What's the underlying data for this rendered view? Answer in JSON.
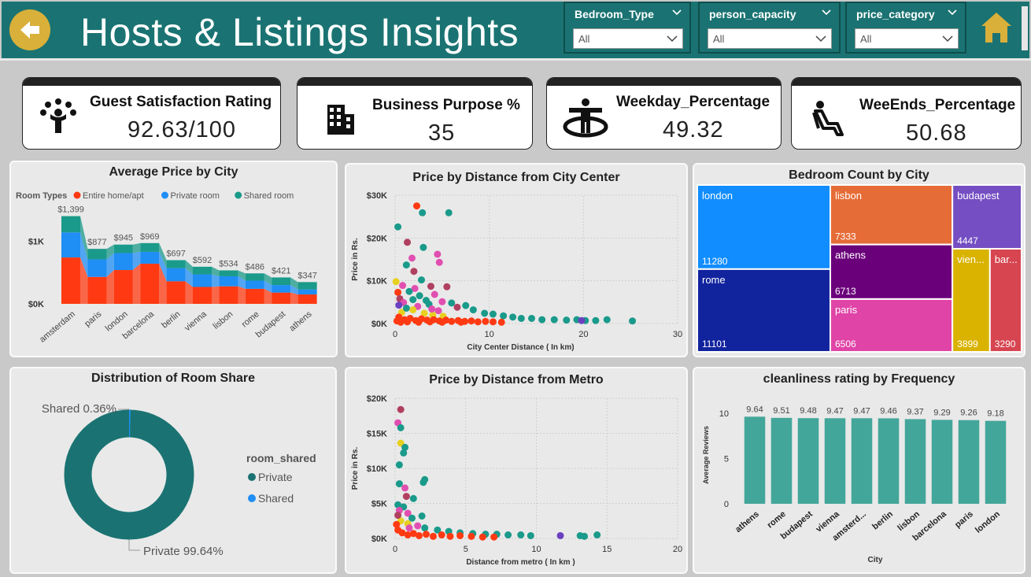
{
  "header": {
    "title": "Hosts & Listings Insights"
  },
  "slicers": [
    {
      "label": "Bedroom_Type",
      "value": "All"
    },
    {
      "label": "person_capacity",
      "value": "All"
    },
    {
      "label": "price_category",
      "value": "All"
    }
  ],
  "kpis": [
    {
      "title": "Guest Satisfaction Rating",
      "value": "92.63/100",
      "icon": "people-group-icon"
    },
    {
      "title": "Business Purpose %",
      "value": "35",
      "icon": "building-icon"
    },
    {
      "title": "Weekday_Percentage",
      "value": "49.32",
      "icon": "person-standing-icon"
    },
    {
      "title": "WeeEnds_Percentage",
      "value": "50.68",
      "icon": "person-seated-icon"
    }
  ],
  "panels": {
    "avg_price": {
      "title": "Average Price by City",
      "legend_title": "Room Types"
    },
    "dist_center": {
      "title": "Price by Distance from City Center"
    },
    "bedroom": {
      "title": "Bedroom Count by City"
    },
    "room_share": {
      "title": "Distribution of Room Share",
      "legend_title": "room_shared",
      "legend": [
        "Private",
        "Shared"
      ],
      "label_shared": "Shared 0.36%",
      "label_private": "Private 99.64%"
    },
    "dist_metro": {
      "title": "Price by Distance from Metro"
    },
    "clean": {
      "title": "cleanliness rating by Frequency"
    }
  },
  "colors": {
    "entire": "#ff3a12",
    "private": "#1f8ef5",
    "shared": "#1a9a8a",
    "teal": "#1a7372",
    "bar": "#43a69a"
  },
  "chart_data": [
    {
      "type": "area",
      "title": "Average Price by City",
      "legend_title": "Room Types",
      "categories": [
        "amsterdam",
        "paris",
        "london",
        "barcelona",
        "berlin",
        "vienna",
        "lisbon",
        "rome",
        "budapest",
        "athens"
      ],
      "totals": [
        "$1,399",
        "$877",
        "$945",
        "$969",
        "$697",
        "$592",
        "$534",
        "$486",
        "$421",
        "$347"
      ],
      "series": [
        {
          "name": "Entire home/apt",
          "color": "#ff3a12",
          "values": [
            740,
            430,
            540,
            640,
            360,
            270,
            280,
            240,
            180,
            150
          ]
        },
        {
          "name": "Private room",
          "color": "#1f8ef5",
          "values": [
            400,
            280,
            270,
            190,
            210,
            200,
            160,
            130,
            120,
            80
          ]
        },
        {
          "name": "Shared room",
          "color": "#1a9a8a",
          "values": [
            259,
            167,
            135,
            139,
            127,
            122,
            94,
            116,
            121,
            117
          ]
        }
      ],
      "yticks": [
        "$0K",
        "$1K"
      ],
      "ylim": [
        0,
        2000
      ]
    },
    {
      "type": "scatter",
      "title": "Price by Distance from City Center",
      "xlabel": "City Center Distance ( In km)",
      "ylabel": "Price in Rs.",
      "xlim": [
        0,
        30
      ],
      "ylim": [
        0,
        30000
      ],
      "xticks": [
        "0",
        "10",
        "20",
        "30"
      ],
      "yticks": [
        "$0K",
        "$10K",
        "$20K",
        "$30K"
      ],
      "points": [
        [
          2.3,
          27500,
          "#ff3a12"
        ],
        [
          2.9,
          25900,
          "#1a9a8a"
        ],
        [
          5.7,
          25900,
          "#1a9a8a"
        ],
        [
          0.3,
          22600,
          "#1a9a8a"
        ],
        [
          1.3,
          19000,
          "#b04060"
        ],
        [
          3.0,
          17800,
          "#1a9a8a"
        ],
        [
          4.5,
          16200,
          "#e04fb0"
        ],
        [
          1.8,
          15300,
          "#e04fb0"
        ],
        [
          4.7,
          14300,
          "#e04fb0"
        ],
        [
          1.2,
          13700,
          "#1a9a8a"
        ],
        [
          2.0,
          12200,
          "#b04060"
        ],
        [
          2.8,
          10200,
          "#1a9a8a"
        ],
        [
          0.8,
          8900,
          "#e04fb0"
        ],
        [
          3.8,
          8700,
          "#b04060"
        ],
        [
          5.5,
          8600,
          "#b04060"
        ],
        [
          2.1,
          8200,
          "#e04fb0"
        ],
        [
          1.5,
          7500,
          "#1a9a8a"
        ],
        [
          0.3,
          7300,
          "#ff3a12"
        ],
        [
          4.2,
          6800,
          "#e04fb0"
        ],
        [
          2.6,
          6500,
          "#1a9a8a"
        ],
        [
          0.5,
          5800,
          "#b04060"
        ],
        [
          1.9,
          5600,
          "#1a9a8a"
        ],
        [
          3.3,
          5400,
          "#1a9a8a"
        ],
        [
          5.0,
          5100,
          "#e04fb0"
        ],
        [
          6.0,
          4800,
          "#1a9a8a"
        ],
        [
          0.9,
          4900,
          "#e04fb0"
        ],
        [
          3.6,
          4500,
          "#1a9a8a"
        ],
        [
          7.5,
          4200,
          "#1a9a8a"
        ],
        [
          2.4,
          4000,
          "#e04fb0"
        ],
        [
          6.6,
          3800,
          "#b04060"
        ],
        [
          8.3,
          3200,
          "#1a9a8a"
        ],
        [
          4.6,
          3000,
          "#e04fb0"
        ],
        [
          9.5,
          2400,
          "#1a9a8a"
        ],
        [
          10.4,
          2200,
          "#1a9a8a"
        ],
        [
          11.5,
          1800,
          "#1a9a8a"
        ],
        [
          12.5,
          1500,
          "#1a9a8a"
        ],
        [
          13.4,
          1200,
          "#1a9a8a"
        ],
        [
          14.5,
          1200,
          "#1a9a8a"
        ],
        [
          15.6,
          900,
          "#1a9a8a"
        ],
        [
          16.9,
          900,
          "#1a9a8a"
        ],
        [
          18.2,
          800,
          "#1a9a8a"
        ],
        [
          19.3,
          900,
          "#1a9a8a"
        ],
        [
          20.2,
          700,
          "#1a9a8a"
        ],
        [
          19.8,
          700,
          "#6b40c0"
        ],
        [
          21.3,
          700,
          "#1a9a8a"
        ],
        [
          22.5,
          900,
          "#1a9a8a"
        ],
        [
          25.2,
          600,
          "#1a9a8a"
        ],
        [
          0.7,
          2600,
          "#e8d020"
        ],
        [
          1.9,
          3200,
          "#e8d020"
        ],
        [
          3.1,
          2400,
          "#e8d020"
        ],
        [
          4.0,
          2000,
          "#e8d020"
        ],
        [
          5.1,
          1700,
          "#e8d020"
        ],
        [
          0.4,
          1500,
          "#ff3a12"
        ],
        [
          1.0,
          900,
          "#ff3a12"
        ],
        [
          1.6,
          1200,
          "#ff3a12"
        ],
        [
          2.2,
          700,
          "#ff3a12"
        ],
        [
          2.8,
          1100,
          "#ff3a12"
        ],
        [
          3.4,
          800,
          "#ff3a12"
        ],
        [
          4.1,
          900,
          "#ff3a12"
        ],
        [
          4.7,
          600,
          "#ff3a12"
        ],
        [
          5.4,
          800,
          "#ff3a12"
        ],
        [
          6.0,
          500,
          "#ff3a12"
        ],
        [
          6.7,
          700,
          "#ff3a12"
        ],
        [
          7.4,
          500,
          "#ff3a12"
        ],
        [
          8.1,
          600,
          "#ff3a12"
        ],
        [
          8.8,
          400,
          "#ff3a12"
        ],
        [
          9.6,
          500,
          "#ff3a12"
        ],
        [
          10.4,
          400,
          "#ff3a12"
        ],
        [
          11.3,
          300,
          "#ff3a12"
        ],
        [
          0.2,
          600,
          "#ff3a12"
        ],
        [
          0.6,
          300,
          "#ff3a12"
        ],
        [
          1.3,
          400,
          "#ff3a12"
        ],
        [
          2.5,
          300,
          "#ff3a12"
        ],
        [
          3.7,
          400,
          "#ff3a12"
        ],
        [
          5.0,
          300,
          "#ff3a12"
        ],
        [
          7.0,
          300,
          "#ff3a12"
        ],
        [
          0.4,
          4300,
          "#6b40c0"
        ],
        [
          1.2,
          3600,
          "#1a9a8a"
        ],
        [
          3.9,
          3400,
          "#e04fb0"
        ],
        [
          0.1,
          9800,
          "#e8d020"
        ]
      ]
    },
    {
      "type": "treemap",
      "title": "Bedroom Count by City",
      "items": [
        {
          "name": "london",
          "value": 11280,
          "color": "#118dff"
        },
        {
          "name": "rome",
          "value": 11101,
          "color": "#12239e"
        },
        {
          "name": "lisbon",
          "value": 7333,
          "color": "#e66c37"
        },
        {
          "name": "athens",
          "value": 6713,
          "color": "#6b007b"
        },
        {
          "name": "paris",
          "value": 6506,
          "color": "#e044a7"
        },
        {
          "name": "budapest",
          "value": 4447,
          "color": "#744ec2"
        },
        {
          "name": "vien...",
          "value": 3899,
          "color": "#d9b300"
        },
        {
          "name": "bar...",
          "value": 3290,
          "color": "#d64550"
        }
      ]
    },
    {
      "type": "pie",
      "title": "Distribution of Room Share",
      "legend_title": "room_shared",
      "slices": [
        {
          "name": "Private",
          "value": 99.64,
          "color": "#1a7372"
        },
        {
          "name": "Shared",
          "value": 0.36,
          "color": "#1f8ef5"
        }
      ]
    },
    {
      "type": "scatter",
      "title": "Price by Distance from Metro",
      "xlabel": "Distance from metro ( In km )",
      "ylabel": "Price in Rs.",
      "xlim": [
        0,
        20
      ],
      "ylim": [
        0,
        20000
      ],
      "xticks": [
        "0",
        "5",
        "10",
        "15",
        "20"
      ],
      "yticks": [
        "$0K",
        "$5K",
        "$10K",
        "$15K",
        "$20K"
      ],
      "points": [
        [
          0.4,
          18400,
          "#b04060"
        ],
        [
          0.2,
          16500,
          "#e04fb0"
        ],
        [
          0.4,
          15800,
          "#1a9a8a"
        ],
        [
          0.4,
          13600,
          "#e8d020"
        ],
        [
          0.7,
          13000,
          "#1a9a8a"
        ],
        [
          0.6,
          12200,
          "#1a9a8a"
        ],
        [
          0.3,
          7800,
          "#1a9a8a"
        ],
        [
          2.0,
          8000,
          "#1a9a8a"
        ],
        [
          0.7,
          7200,
          "#e04fb0"
        ],
        [
          0.8,
          6000,
          "#b04060"
        ],
        [
          1.3,
          5700,
          "#1a9a8a"
        ],
        [
          0.2,
          4800,
          "#1a9a8a"
        ],
        [
          0.6,
          4500,
          "#1a9a8a"
        ],
        [
          0.3,
          4000,
          "#e04fb0"
        ],
        [
          0.9,
          3600,
          "#e04fb0"
        ],
        [
          1.9,
          3200,
          "#1a9a8a"
        ],
        [
          1.2,
          2900,
          "#1a9a8a"
        ],
        [
          0.4,
          2500,
          "#e8d020"
        ],
        [
          0.9,
          2100,
          "#e8d020"
        ],
        [
          1.6,
          1800,
          "#e04fb0"
        ],
        [
          2.1,
          1500,
          "#1a9a8a"
        ],
        [
          3.0,
          1200,
          "#1a9a8a"
        ],
        [
          3.8,
          1000,
          "#1a9a8a"
        ],
        [
          4.6,
          800,
          "#1a9a8a"
        ],
        [
          5.5,
          700,
          "#1a9a8a"
        ],
        [
          6.4,
          600,
          "#1a9a8a"
        ],
        [
          7.2,
          600,
          "#1a9a8a"
        ],
        [
          8.0,
          500,
          "#1a9a8a"
        ],
        [
          8.9,
          500,
          "#1a9a8a"
        ],
        [
          9.6,
          400,
          "#1a9a8a"
        ],
        [
          11.7,
          400,
          "#6b40c0"
        ],
        [
          13.1,
          400,
          "#1a9a8a"
        ],
        [
          13.4,
          300,
          "#1a9a8a"
        ],
        [
          14.3,
          500,
          "#1a9a8a"
        ],
        [
          0.2,
          1200,
          "#ff3a12"
        ],
        [
          0.5,
          800,
          "#ff3a12"
        ],
        [
          0.9,
          500,
          "#ff3a12"
        ],
        [
          1.3,
          700,
          "#ff3a12"
        ],
        [
          1.7,
          400,
          "#ff3a12"
        ],
        [
          2.2,
          600,
          "#ff3a12"
        ],
        [
          2.7,
          300,
          "#ff3a12"
        ],
        [
          3.3,
          500,
          "#ff3a12"
        ],
        [
          3.9,
          300,
          "#ff3a12"
        ],
        [
          4.6,
          400,
          "#ff3a12"
        ],
        [
          5.4,
          300,
          "#ff3a12"
        ],
        [
          6.2,
          200,
          "#ff3a12"
        ],
        [
          7.0,
          200,
          "#ff3a12"
        ],
        [
          0.1,
          2000,
          "#ff3a12"
        ],
        [
          1.0,
          1500,
          "#e04fb0"
        ],
        [
          0.3,
          10500,
          "#1a9a8a"
        ],
        [
          2.1,
          8400,
          "#1a9a8a"
        ],
        [
          0.2,
          3300,
          "#b04060"
        ]
      ]
    },
    {
      "type": "bar",
      "title": "cleanliness rating by Frequency",
      "xlabel": "City",
      "ylabel": "Average Reviews",
      "categories": [
        "athens",
        "rome",
        "budapest",
        "vienna",
        "amsterd...",
        "berlin",
        "lisbon",
        "barcelona",
        "paris",
        "london"
      ],
      "values": [
        9.64,
        9.51,
        9.48,
        9.47,
        9.47,
        9.46,
        9.37,
        9.29,
        9.26,
        9.18
      ],
      "yticks": [
        "0",
        "5",
        "10"
      ],
      "ylim": [
        0,
        11.5
      ]
    }
  ]
}
